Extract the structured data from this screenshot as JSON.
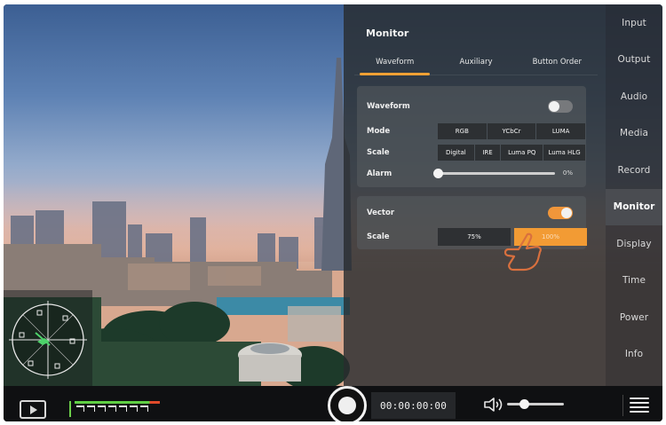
{
  "side_menu": {
    "items": [
      {
        "label": "Input",
        "active": false
      },
      {
        "label": "Output",
        "active": false
      },
      {
        "label": "Audio",
        "active": false
      },
      {
        "label": "Media",
        "active": false
      },
      {
        "label": "Record",
        "active": false
      },
      {
        "label": "Monitor",
        "active": true
      },
      {
        "label": "Display",
        "active": false
      },
      {
        "label": "Time",
        "active": false
      },
      {
        "label": "Power",
        "active": false
      },
      {
        "label": "Info",
        "active": false
      }
    ]
  },
  "monitor": {
    "title": "Monitor",
    "tabs": [
      {
        "label": "Waveform",
        "active": true
      },
      {
        "label": "Auxiliary",
        "active": false
      },
      {
        "label": "Button Order",
        "active": false
      }
    ],
    "waveform": {
      "label": "Waveform",
      "enabled": false,
      "mode": {
        "label": "Mode",
        "options": [
          "RGB",
          "YCbCr",
          "LUMA"
        ]
      },
      "scale": {
        "label": "Scale",
        "options": [
          "Digital",
          "IRE",
          "Luma PQ",
          "Luma HLG"
        ]
      },
      "alarm": {
        "label": "Alarm",
        "value": "0%",
        "level": 0
      }
    },
    "vector": {
      "label": "Vector",
      "enabled": true,
      "scale": {
        "label": "Scale",
        "options": [
          "75%",
          "100%"
        ],
        "selected": "100%"
      }
    }
  },
  "bottom_bar": {
    "timecode": "00:00:00:00",
    "volume_level": 0.3
  },
  "colors": {
    "accent": "#f0a134",
    "panel": "#282c2e",
    "active_menu": "#4a4c51"
  },
  "icons": [
    "play-icon",
    "audio-meter-icon",
    "record-icon",
    "speaker-icon",
    "menu-icon",
    "pointing-hand-icon",
    "vectorscope-icon"
  ]
}
